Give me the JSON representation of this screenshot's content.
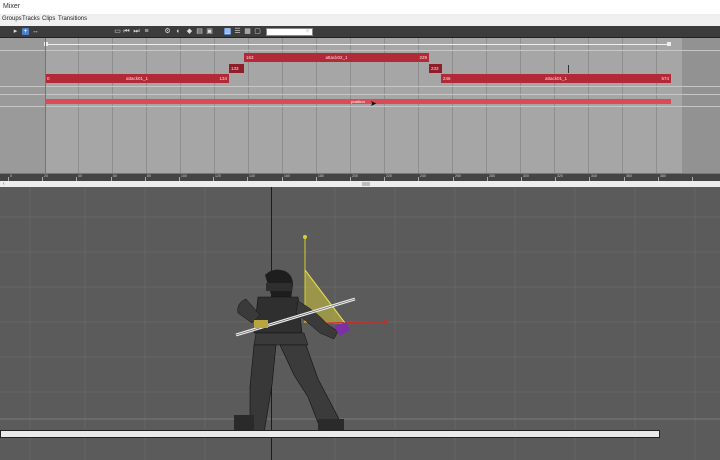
{
  "window": {
    "title": "Mixer"
  },
  "menu": {
    "items": [
      "Groups",
      "Tracks",
      "Clips",
      "Transitions"
    ]
  },
  "toolbar": {
    "field_value": ""
  },
  "tracks": {
    "clips": [
      {
        "name": "attack02_1",
        "start": "163",
        "end": "229"
      },
      {
        "name": "attack01_1",
        "start": "0",
        "end": "134"
      },
      {
        "name": "attack01_1",
        "start": "246",
        "end": "574"
      }
    ],
    "small_labels": [
      "133",
      "233"
    ],
    "red_bar_label": "position"
  },
  "ruler": {
    "labels": [
      "0",
      "20",
      "40",
      "60",
      "80",
      "100",
      "120",
      "140",
      "160",
      "180",
      "200",
      "220",
      "240",
      "260",
      "280",
      "300",
      "320",
      "340",
      "360",
      "380"
    ]
  },
  "colors": {
    "clip": "#b22a37",
    "playhead": "#a24bd6",
    "bar": "#dc4b55"
  }
}
